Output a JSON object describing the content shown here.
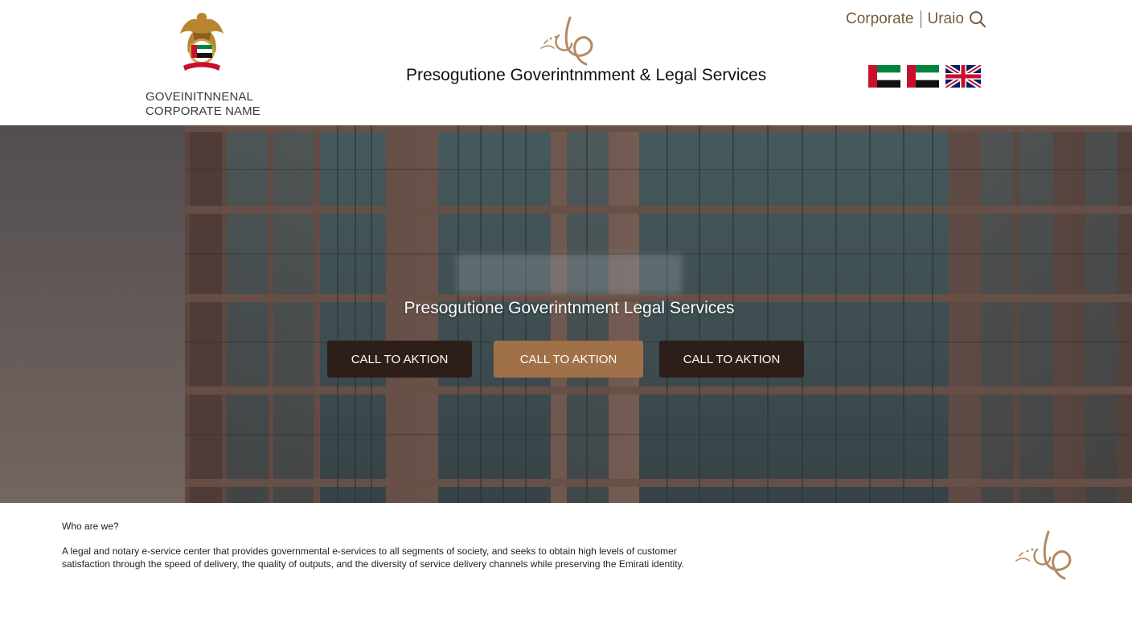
{
  "header": {
    "corporate_name_line1": "GOVEINITNNENAL",
    "corporate_name_line2": "CORPORATE NAME",
    "site_title": "Presogutione Goverintnmment & Legal Services",
    "links": {
      "corporate": "Corporate",
      "uraio": "Uraio"
    },
    "icons": {
      "search": "search-icon",
      "emblem": "uae-emblem-icon",
      "logo": "calligraphy-logo-icon"
    },
    "flags": [
      "uae-flag-icon",
      "uae-flag-icon",
      "uk-flag-icon"
    ]
  },
  "hero": {
    "title": "Presogutione Goverintnment Legal Services",
    "buttons": [
      "CALL TO AKTION",
      "CALL TO AKTION",
      "CALL TO AKTION"
    ]
  },
  "about": {
    "heading": "Who are we?",
    "text": "A legal and notary e-service center that provides governmental e-services to all segments of society, and seeks to obtain high levels of customer satisfaction through the speed of delivery, the quality of outputs, and the diversity of service delivery channels while preserving the Emirati identity."
  },
  "colors": {
    "accent": "#a07048",
    "dark_button": "#2e1e1a",
    "link": "#7a5a3a",
    "uae_green": "#00843d",
    "uae_red": "#c8102e",
    "uk_blue": "#012169"
  }
}
